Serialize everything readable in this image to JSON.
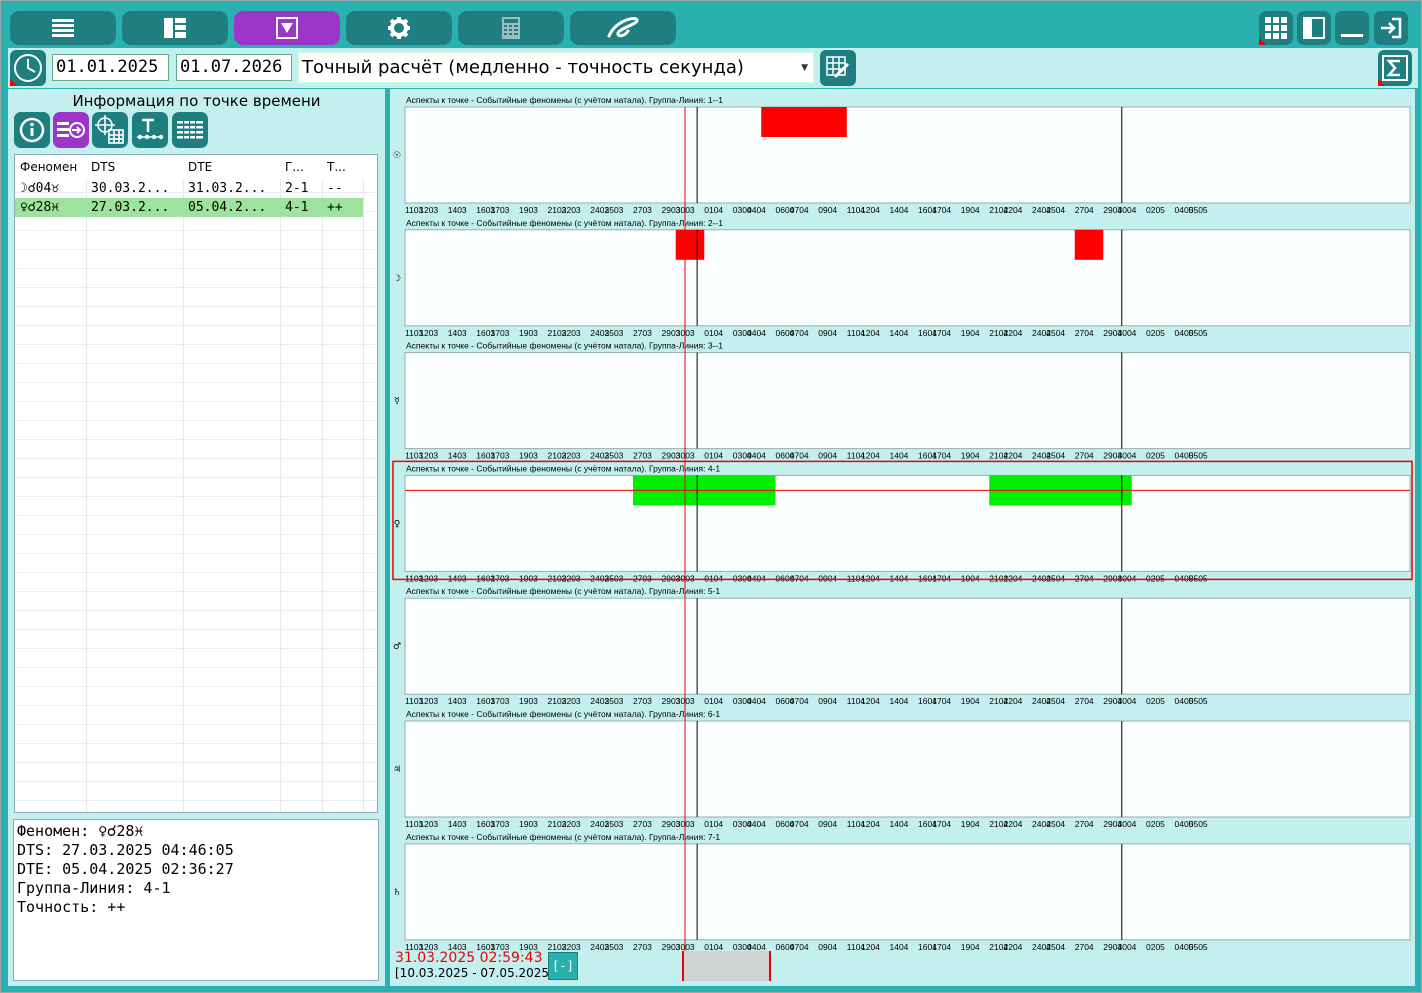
{
  "toolbar": {
    "tabs": [
      {
        "icon": "menu-lines-icon"
      },
      {
        "icon": "dashboard-layout-icon"
      },
      {
        "icon": "filter-triangle-icon",
        "active": true
      },
      {
        "icon": "gear-icon"
      },
      {
        "icon": "calculator-icon"
      },
      {
        "icon": "logo-swirl-icon"
      }
    ],
    "right_buttons": [
      "apps-grid-icon",
      "split-view-icon",
      "minimize-icon",
      "exit-icon"
    ]
  },
  "period": {
    "start_date": "01.01.2025",
    "end_date": "01.07.2026",
    "mode": "Точный расчёт (медленно - точность секунда)"
  },
  "info_panel": {
    "title": "Информация по точке времени",
    "tool_buttons": [
      "info-icon",
      "phenomenon-arrow-icon",
      "crosshair-grid-icon",
      "text-timeline-icon",
      "list-grid-icon"
    ],
    "table": {
      "headers": [
        "Феномен",
        "DTS",
        "DTE",
        "Г...",
        "Т..."
      ],
      "rows": [
        {
          "phenomenon": "☽☌04♉",
          "dts": "30.03.2...",
          "dte": "31.03.2...",
          "group": "2-1",
          "accuracy": "--",
          "selected": false
        },
        {
          "phenomenon": "♀☌28♓",
          "dts": "27.03.2...",
          "dte": "05.04.2...",
          "group": "4-1",
          "accuracy": "++",
          "selected": true
        }
      ]
    },
    "detail": {
      "phenomenon": "Феномен: ♀☌28♓",
      "dts": "DTS: 27.03.2025 04:46:05",
      "dte": "DTE: 05.04.2025 02:36:27",
      "group": "Группа-Линия: 4-1",
      "accuracy": "Точность: ++"
    }
  },
  "status": {
    "cursor_time": "31.03.2025 02:59:43",
    "visible_range": "[10.03.2025 - 07.05.2025]",
    "zoom_button": "[-]"
  },
  "colors": {
    "teal": "#2bb0b0",
    "teal_dark": "#1e7e80",
    "panel_bg": "#c4efef",
    "accent_purple": "#9b36c8",
    "bar_red": "#ff0000",
    "bar_green": "#00ee00"
  },
  "chart_data": [
    {
      "type": "timeline",
      "title": "Аспекты к точке - Событийные феномены (с учётом натала). Группа-Линия: 1--1",
      "ylabel": "☉",
      "categories": [
        "1103",
        "1203",
        "1403",
        "1603",
        "1703",
        "1903",
        "2103",
        "2203",
        "2403",
        "2503",
        "2703",
        "2903",
        "3003",
        "0104",
        "0304",
        "0404",
        "0604",
        "0704",
        "0904",
        "1104",
        "1204",
        "1404",
        "1604",
        "1704",
        "1904",
        "2104",
        "2204",
        "2404",
        "2504",
        "2704",
        "2904",
        "3004",
        "0205",
        "0405",
        "0505"
      ],
      "bars": [
        {
          "start": "05.04.2025",
          "end": "10.04.2025",
          "color": "red"
        }
      ]
    },
    {
      "type": "timeline",
      "title": "Аспекты к точке - Событийные феномены (с учётом натала). Группа-Линия: 2--1",
      "ylabel": "☽",
      "categories": [
        "1103",
        "1203",
        "1403",
        "1603",
        "1703",
        "1903",
        "2103",
        "2203",
        "2403",
        "2503",
        "2703",
        "2903",
        "3003",
        "0104",
        "0304",
        "0404",
        "0604",
        "0704",
        "0904",
        "1104",
        "1204",
        "1404",
        "1604",
        "1704",
        "1904",
        "2104",
        "2204",
        "2404",
        "2504",
        "2704",
        "2904",
        "3004",
        "0205",
        "0405",
        "0505"
      ],
      "bars": [
        {
          "start": "30.03.2025",
          "end": "31.03.2025",
          "color": "red"
        },
        {
          "start": "27.04.2025",
          "end": "28.04.2025",
          "color": "red"
        }
      ]
    },
    {
      "type": "timeline",
      "title": "Аспекты к точке - Событийные феномены (с учётом натала). Группа-Линия: 3--1",
      "ylabel": "☿",
      "categories": [
        "1103",
        "1203",
        "1403",
        "1603",
        "1703",
        "1903",
        "2103",
        "2203",
        "2403",
        "2503",
        "2703",
        "2903",
        "3003",
        "0104",
        "0304",
        "0404",
        "0604",
        "0704",
        "0904",
        "1104",
        "1204",
        "1404",
        "1604",
        "1704",
        "1904",
        "2104",
        "2204",
        "2404",
        "2504",
        "2704",
        "2904",
        "3004",
        "0205",
        "0405",
        "0505"
      ],
      "bars": []
    },
    {
      "type": "timeline",
      "title": "Аспекты к точке - Событийные феномены (с учётом натала). Группа-Линия: 4-1",
      "ylabel": "♀",
      "categories": [
        "1103",
        "1203",
        "1403",
        "1603",
        "1703",
        "1903",
        "2103",
        "2203",
        "2403",
        "2503",
        "2703",
        "2903",
        "3003",
        "0104",
        "0304",
        "0404",
        "0604",
        "0704",
        "0904",
        "1104",
        "1204",
        "1404",
        "1604",
        "1704",
        "1904",
        "2104",
        "2204",
        "2404",
        "2504",
        "2704",
        "2904",
        "3004",
        "0205",
        "0405",
        "0505"
      ],
      "bars": [
        {
          "start": "27.03.2025",
          "end": "05.04.2025",
          "color": "green"
        },
        {
          "start": "21.04.2025",
          "end": "30.04.2025",
          "color": "green"
        }
      ],
      "selected": true
    },
    {
      "type": "timeline",
      "title": "Аспекты к точке - Событийные феномены (с учётом натала). Группа-Линия: 5-1",
      "ylabel": "♂",
      "categories": [
        "1103",
        "1203",
        "1403",
        "1603",
        "1703",
        "1903",
        "2103",
        "2203",
        "2403",
        "2503",
        "2703",
        "2903",
        "3003",
        "0104",
        "0304",
        "0404",
        "0604",
        "0704",
        "0904",
        "1104",
        "1204",
        "1404",
        "1604",
        "1704",
        "1904",
        "2104",
        "2204",
        "2404",
        "2504",
        "2704",
        "2904",
        "3004",
        "0205",
        "0405",
        "0505"
      ],
      "bars": []
    },
    {
      "type": "timeline",
      "title": "Аспекты к точке - Событийные феномены (с учётом натала). Группа-Линия: 6-1",
      "ylabel": "♃",
      "categories": [
        "1103",
        "1203",
        "1403",
        "1603",
        "1703",
        "1903",
        "2103",
        "2203",
        "2403",
        "2503",
        "2703",
        "2903",
        "3003",
        "0104",
        "0304",
        "0404",
        "0604",
        "0704",
        "0904",
        "1104",
        "1204",
        "1404",
        "1604",
        "1704",
        "1904",
        "2104",
        "2204",
        "2404",
        "2504",
        "2704",
        "2904",
        "3004",
        "0205",
        "0405",
        "0505"
      ],
      "bars": []
    },
    {
      "type": "timeline",
      "title": "Аспекты к точке - Событийные феномены (с учётом натала). Группа-Линия: 7-1",
      "ylabel": "♄",
      "categories": [
        "1103",
        "1203",
        "1403",
        "1603",
        "1703",
        "1903",
        "2103",
        "2203",
        "2403",
        "2503",
        "2703",
        "2903",
        "3003",
        "0104",
        "0304",
        "0404",
        "0604",
        "0704",
        "0904",
        "1104",
        "1204",
        "1404",
        "1604",
        "1704",
        "1904",
        "2104",
        "2204",
        "2404",
        "2504",
        "2704",
        "2904",
        "3004",
        "0205",
        "0405",
        "0505"
      ],
      "bars": []
    }
  ]
}
